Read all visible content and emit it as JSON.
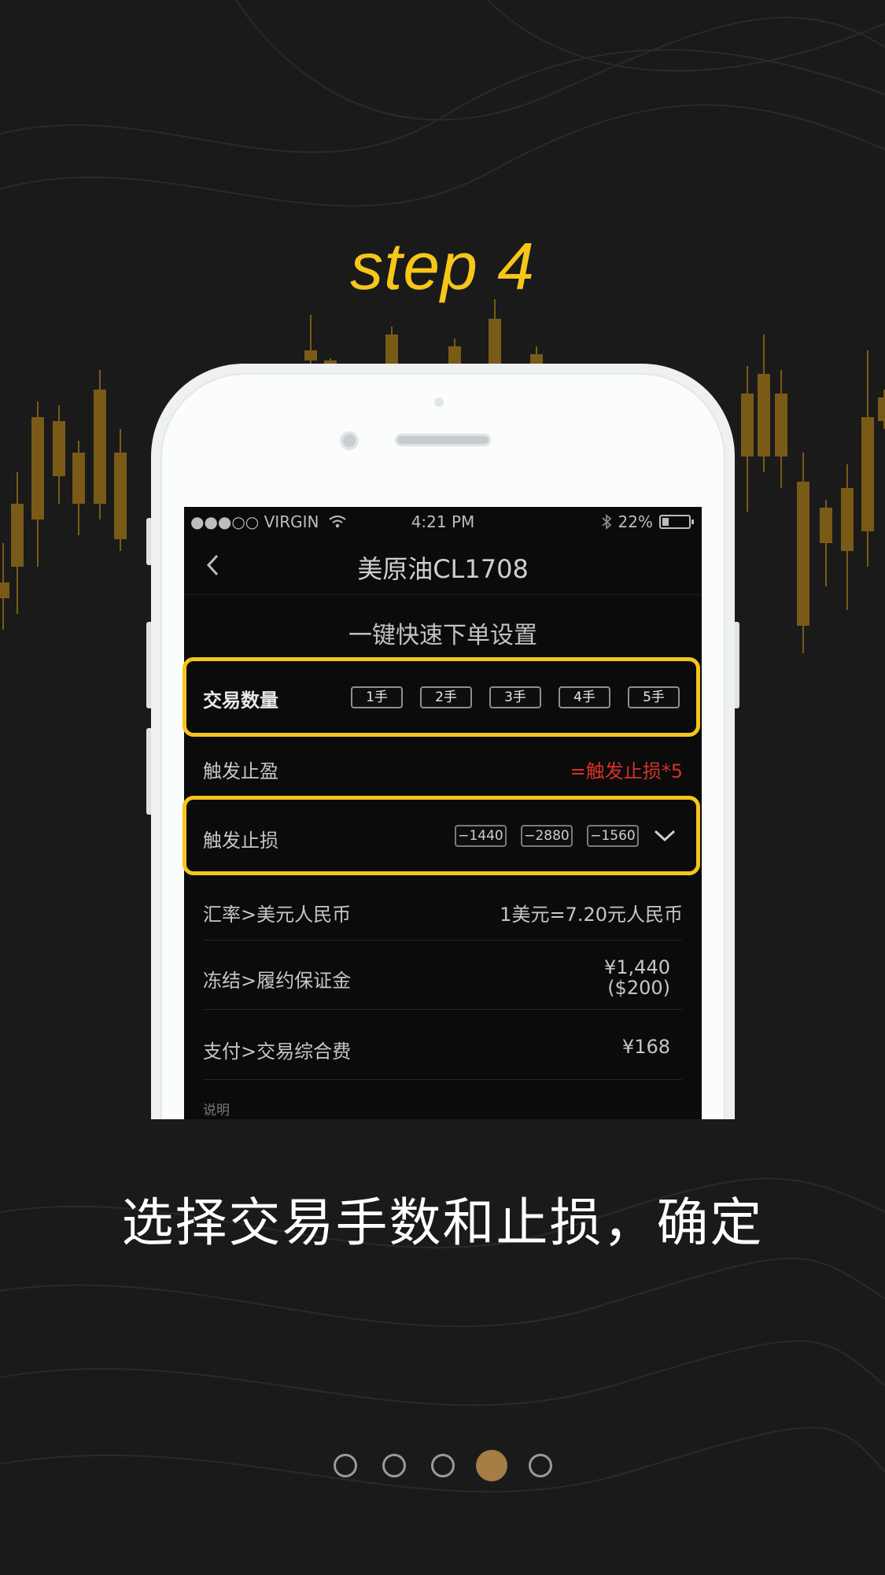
{
  "step_title": "step 4",
  "status_bar": {
    "carrier": "●●●○○ VIRGIN",
    "time": "4:21 PM",
    "battery": "22%"
  },
  "nav": {
    "title": "美原油CL1708"
  },
  "section_title": "一键快速下单设置",
  "quantity": {
    "label": "交易数量",
    "options": [
      "1手",
      "2手",
      "3手",
      "4手",
      "5手"
    ]
  },
  "take_profit": {
    "label": "触发止盈",
    "value": "=触发止损*5",
    "value_color": "#d7322b"
  },
  "stop_loss": {
    "label": "触发止损",
    "options": [
      "−1440",
      "−2880",
      "−1560"
    ]
  },
  "exchange_rate": {
    "label": "汇率>美元人民币",
    "value": "1美元=7.20元人民币"
  },
  "margin": {
    "label": "冻结>履约保证金",
    "value_cny": "¥1,440",
    "value_usd": "($200)"
  },
  "fee": {
    "label": "支付>交易综合费",
    "value": "¥168"
  },
  "note_label": "说明",
  "caption": "选择交易手数和止损，确定",
  "pagination": {
    "total": 5,
    "active_index": 3
  },
  "colors": {
    "accent": "#f7c51a",
    "active_dot": "#a77d46",
    "background": "#1a1a1b",
    "candles": "#7a5a17"
  }
}
